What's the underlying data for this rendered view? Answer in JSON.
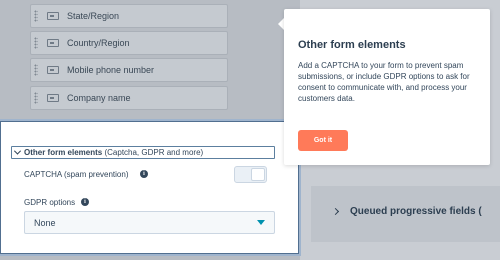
{
  "fields": [
    {
      "label": "State/Region"
    },
    {
      "label": "Country/Region"
    },
    {
      "label": "Mobile phone number"
    },
    {
      "label": "Company name"
    }
  ],
  "panel": {
    "title_bold": "Other form elements",
    "title_rest": " (Captcha, GDPR and more)",
    "captcha_label": "CAPTCHA (spam prevention)",
    "captcha_enabled": false,
    "gdpr_label": "GDPR options",
    "gdpr_value": "None"
  },
  "queued": {
    "label": "Queued progressive fields ("
  },
  "tooltip": {
    "title": "Other form elements",
    "body": "Add a CAPTCHA to your form to prevent spam submissions, or include GDPR options to ask for consent to communicate with, and process your customers data.",
    "button": "Got it"
  },
  "colors": {
    "accent_button": "#ff7a59",
    "caret": "#0091ae",
    "text": "#33475b"
  }
}
